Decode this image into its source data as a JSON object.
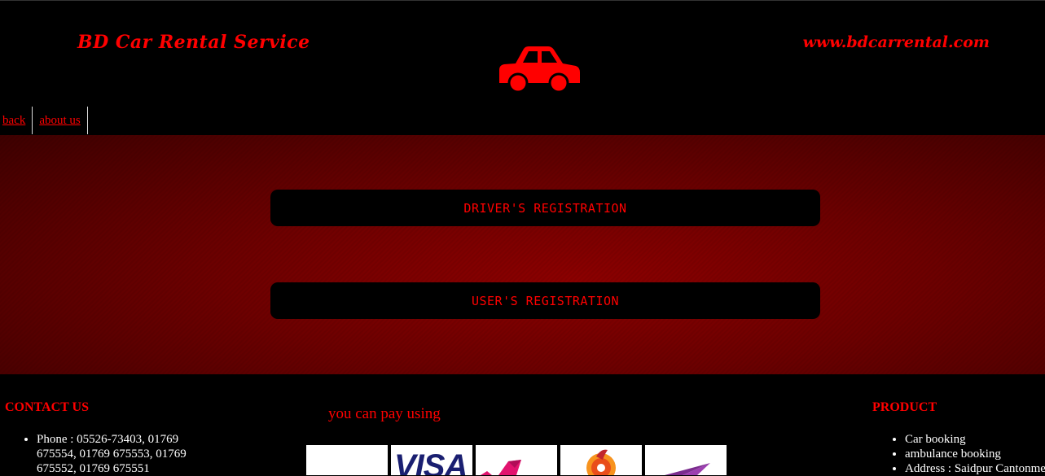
{
  "header": {
    "brand": "BD Car Rental Service",
    "website": "www.bdcarrental.com",
    "logo_icon": "car-icon"
  },
  "nav": {
    "items": [
      {
        "label": "back"
      },
      {
        "label": "about us"
      }
    ]
  },
  "main": {
    "driver_registration": "DRIVER'S REGISTRATION",
    "user_registration": "USER'S REGISTRATION"
  },
  "footer": {
    "contact": {
      "title": "CONTACT US",
      "items": [
        "Phone : 05526-73403, 01769 675554, 01769 675553, 01769 675552, 01769 675551"
      ]
    },
    "payment": {
      "title": "you can pay using",
      "logos": [
        "blank-logo",
        "visa-logo",
        "bkash-logo",
        "rocket-logo",
        "payment-arrow-logo"
      ],
      "visa_text": "VISA"
    },
    "product": {
      "title": "PRODUCT",
      "items": [
        "Car booking",
        "ambulance booking",
        "Address : Saidpur Cantonment"
      ]
    }
  },
  "colors": {
    "accent": "#ff0000",
    "background": "#000000",
    "hero": "#7a0000"
  }
}
